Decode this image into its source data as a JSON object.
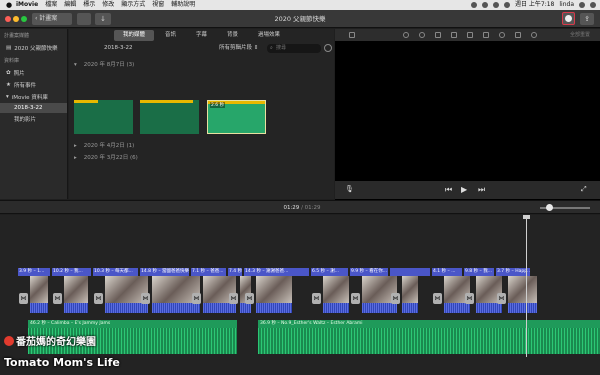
{
  "menubar": {
    "app": "iMovie",
    "items": [
      "檔案",
      "編輯",
      "標示",
      "修改",
      "顯示方式",
      "視窗",
      "輔助說明"
    ],
    "clock": "週日 上午7:18",
    "user": "linda"
  },
  "toolbar": {
    "projects_label": "‹ 計畫案",
    "window_title": "2020 父親節快樂",
    "export_glyph": "⇪"
  },
  "sidebar": {
    "header_projects": "計畫案媒體",
    "project_item": "2020 父親節快樂",
    "header_library": "資料庫",
    "photos": "照片",
    "all_events": "所有事件",
    "library": "iMovie 資料庫",
    "event_selected": "2018-3-22",
    "my_movies": "我的影片"
  },
  "browser": {
    "tabs": [
      "我的媒體",
      "音訊",
      "字幕",
      "背景",
      "過場效果"
    ],
    "event_name": "2018-3-22",
    "clip_filter": "所有剪輯片段 ⇕",
    "search_placeholder": "搜尋",
    "groups": [
      {
        "label": "2020 年 8月7日",
        "count": "(3)",
        "expanded": true
      },
      {
        "label": "2020 年 4月2日",
        "count": "(1)",
        "expanded": false
      },
      {
        "label": "2020 年 3月22日",
        "count": "(6)",
        "expanded": false
      }
    ],
    "selected_thumb_duration": "2.6 秒"
  },
  "viewer": {
    "reset_all": "全部重置"
  },
  "timeline": {
    "current_time": "01:29",
    "separator": "/",
    "total_time": "01:29",
    "clip_titles": [
      "3.9 秒 – 1...",
      "10.2 秒 – 我...",
      "10.3 秒 – 每天都...",
      "14.8 秒 – 當國爸爸快樂",
      "7.1 秒 – 爸爸...",
      "7.4 秒 – 我...",
      "14.3 秒 – 謝謝爸爸...",
      "6.5 秒 – 謝...",
      "9.9 秒 – 看在你...",
      "",
      "4.1 秒 – ...",
      "9.8 秒 – 我...",
      "3.7 秒 – Happ..."
    ],
    "music": [
      {
        "title": "46.2 秒 – Calimba – E's Jammy Jams"
      },
      {
        "title": "36.9 秒 – No.9_Esther's Waltz – Esther Abrami"
      }
    ],
    "transition_glyph": "⋈"
  },
  "watermark": {
    "line1": "番茄媽的奇幻樂園",
    "line2": "Tomato Mom's Life"
  },
  "colors": {
    "accent_red": "#d83a4b",
    "video_clip": "#3b4cc0",
    "music_clip": "#1f9a5a",
    "selection_yellow": "#e8b800"
  }
}
